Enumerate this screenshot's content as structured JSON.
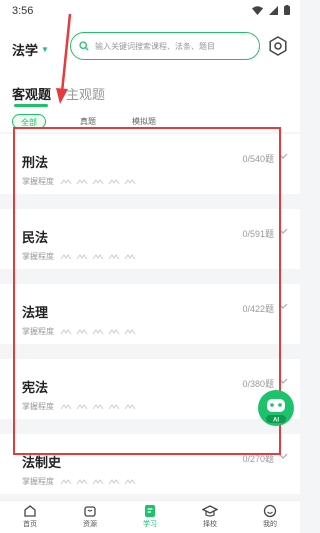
{
  "status": {
    "time": "3:56"
  },
  "header": {
    "subject": "法学",
    "search_placeholder": "输入关键词搜索课程、法条、题目"
  },
  "tabs": {
    "active": "客观题",
    "inactive": "主观题"
  },
  "filters": {
    "all": "全部",
    "real": "真题",
    "mock": "模拟题"
  },
  "mastery_label": "掌握程度",
  "subjects": [
    {
      "name": "刑法",
      "count": "0/540题"
    },
    {
      "name": "民法",
      "count": "0/591题"
    },
    {
      "name": "法理",
      "count": "0/422题"
    },
    {
      "name": "宪法",
      "count": "0/380题"
    },
    {
      "name": "法制史",
      "count": "0/270题"
    }
  ],
  "ai_label": "AI助手",
  "bottom_nav": [
    {
      "label": "首页"
    },
    {
      "label": "资源"
    },
    {
      "label": "学习"
    },
    {
      "label": "择校"
    },
    {
      "label": "我的"
    }
  ],
  "colors": {
    "accent": "#1ec26b",
    "highlight": "#e8393d"
  }
}
